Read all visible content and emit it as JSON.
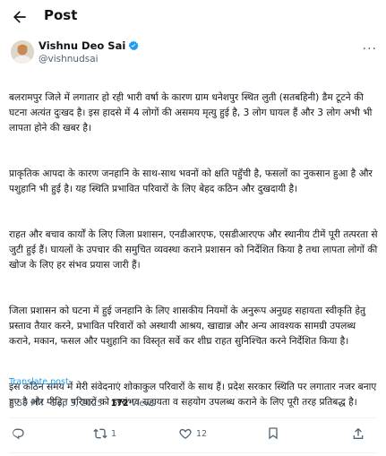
{
  "header": {
    "title": "Post"
  },
  "author": {
    "name": "Vishnu Deo Sai",
    "handle": "@vishnudsai"
  },
  "post": {
    "paragraphs": [
      "बलरामपुर जिले में लगातार हो रही भारी वर्षा के कारण ग्राम धनेशपुर स्थित लुती (सतबहिनी) डैम टूटने की घटना अत्यंत दुःखद है। इस हादसे में 4 लोगों की असमय मृत्यु हुई है, 3 लोग घायल हैं और 3 लोग अभी भी लापता होने की खबर है।",
      "प्राकृतिक आपदा के कारण जनहानि के साथ-साथ भवनों को क्षति पहुँची है, फसलों का नुकसान हुआ है और पशुहानि भी हुई है। यह स्थिति प्रभावित परिवारों के लिए बेहद कठिन और दुखदायी है।",
      "राहत और बचाव कार्यों के लिए जिला प्रशासन, एनडीआरएफ, एसडीआरएफ और स्थानीय टीमें पूरी तत्परता से जुटी हुई हैं। घायलों के उपचार की समुचित व्यवस्था कराने प्रशासन को निर्देशित किया है तथा लापता लोगों की खोज के लिए हर संभव प्रयास जारी हैं।",
      "जिला प्रशासन को घटना में हुई जनहानि के लिए शासकीय नियमों के अनुरूप अनुग्रह सहायता स्वीकृति हेतु प्रस्ताव तैयार करने, प्रभावित परिवारों को अस्थायी आश्रय, खाद्यान्न और अन्य आवश्यक सामग्री उपलब्ध कराने, मकान, फसल और पशुहानि का विस्तृत सर्वे कर शीघ्र राहत सुनिश्चित करने निर्देशित किया है।",
      "इस कठिन समय में मेरी संवेदनाएं शोकाकुल परिवारों के साथ हैं। प्रदेश सरकार स्थिति पर लगातार नजर बनाए हुए है और पीड़ित परिवारों को हरसंभव सहायता व सहयोग उपलब्ध कराने के लिए पूरी तरह प्रतिबद्ध है।"
    ],
    "translate_label": "Translate post",
    "time": "2:59 PM · Sep 3, 2025 · ",
    "views_count": "172",
    "views_label": " Views"
  },
  "actions": {
    "reposts": "1",
    "likes": "12"
  },
  "icons": [
    "back-arrow-icon",
    "verified-badge-icon",
    "more-icon",
    "reply-icon",
    "repost-icon",
    "like-icon",
    "bookmark-icon",
    "share-icon"
  ],
  "colors": {
    "accent": "#1d9bf0",
    "secondary_text": "#536471"
  }
}
